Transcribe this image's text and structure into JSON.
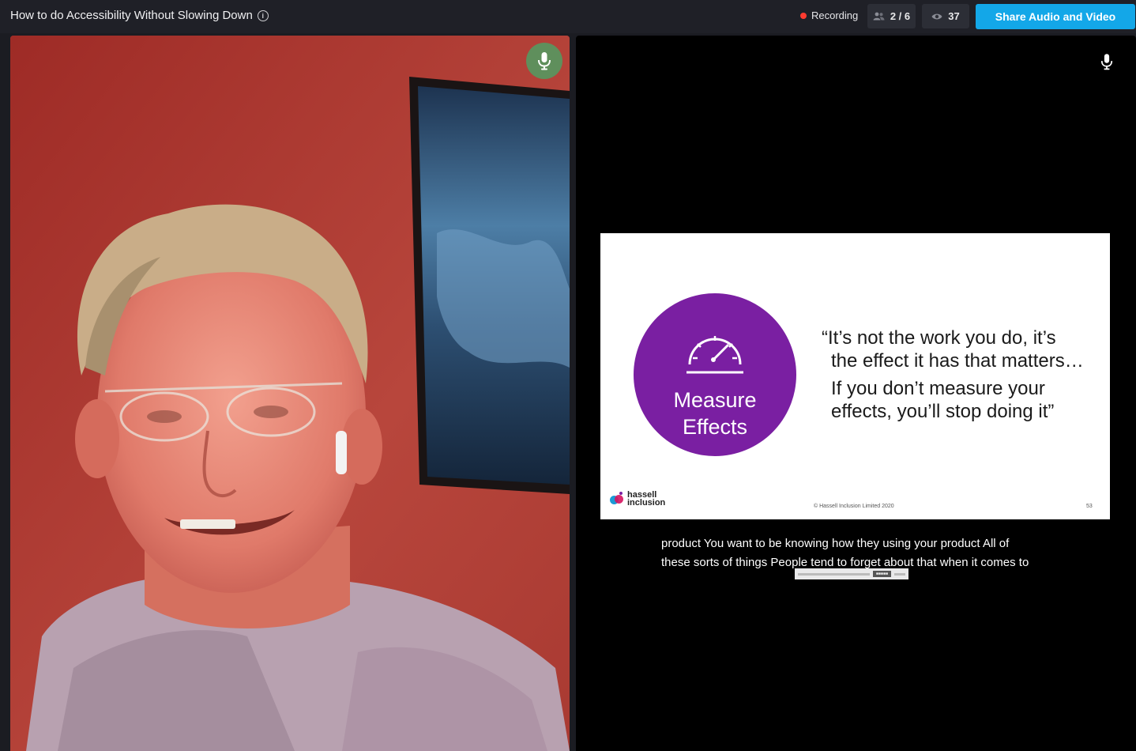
{
  "header": {
    "title": "How to do Accessibility Without Slowing Down",
    "recording_label": "Recording",
    "participants": "2 / 6",
    "viewers": "37",
    "share_button": "Share Audio and Video"
  },
  "slide": {
    "circle_title_line1": "Measure",
    "circle_title_line2": "Effects",
    "quote_line1": "“It’s not the work you do, it’s",
    "quote_line2": "the effect it has that matters…",
    "quote_line3": "If you don’t measure your",
    "quote_line4": "effects, you’ll stop doing it”",
    "logo_line1": "hassell",
    "logo_line2": "inclusion",
    "copyright": "© Hassell Inclusion Limited 2020",
    "page_number": "53"
  },
  "captions": {
    "line1": "product You want to be knowing how they using your product All of",
    "line2": "these sorts of things People tend to forget about that when it comes to"
  },
  "colors": {
    "accent": "#13a7e8",
    "recording": "#ff3b30",
    "slide_purple": "#7a1fa2",
    "mic_active": "#5f8f5c"
  }
}
